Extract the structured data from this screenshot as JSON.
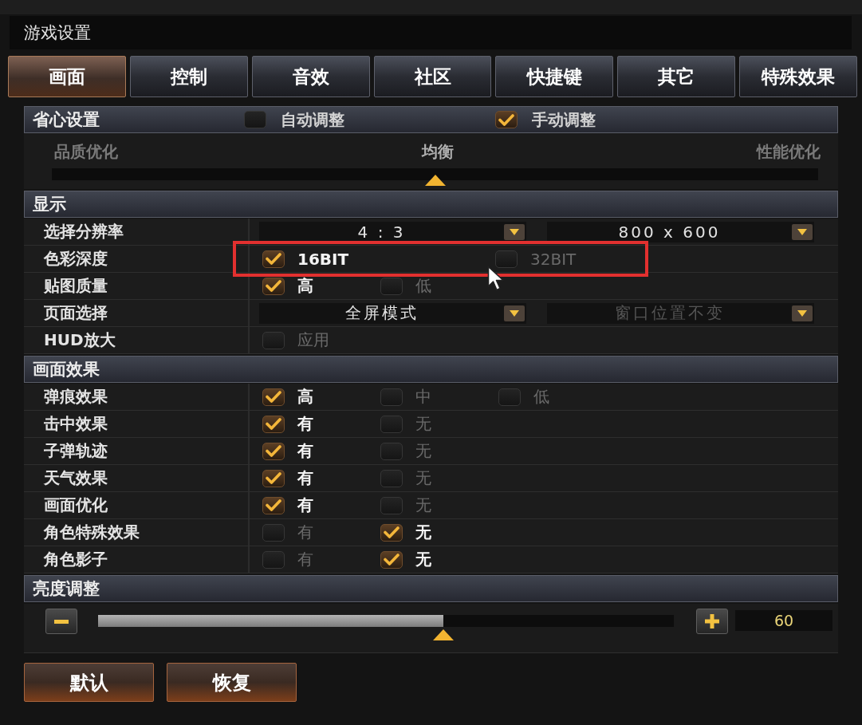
{
  "window": {
    "title": "游戏设置"
  },
  "tabs": [
    {
      "label": "画面",
      "selected": true
    },
    {
      "label": "控制",
      "selected": false
    },
    {
      "label": "音效",
      "selected": false
    },
    {
      "label": "社区",
      "selected": false
    },
    {
      "label": "快捷键",
      "selected": false
    },
    {
      "label": "其它",
      "selected": false
    },
    {
      "label": "特殊效果",
      "selected": false
    }
  ],
  "quick_settings": {
    "title": "省心设置",
    "options": [
      {
        "label": "自动调整",
        "checked": false
      },
      {
        "label": "手动调整",
        "checked": true
      }
    ],
    "preset_slider": {
      "labels": [
        {
          "text": "品质优化",
          "selected": false
        },
        {
          "text": "均衡",
          "selected": true
        },
        {
          "text": "性能优化",
          "selected": false
        }
      ],
      "level": 0.5
    }
  },
  "display": {
    "title": "显示",
    "rows": [
      {
        "label": "选择分辨率",
        "kind": "dropdowns",
        "highlighted": false,
        "dropdowns": [
          {
            "value": "4 : 3",
            "disabled": false
          },
          {
            "value": "800 x 600",
            "disabled": false
          }
        ]
      },
      {
        "label": "色彩深度",
        "kind": "wide-checks",
        "highlighted": true,
        "options": [
          {
            "label": "16BIT",
            "checked": true
          },
          {
            "label": "32BIT",
            "checked": false
          }
        ]
      },
      {
        "label": "贴图质量",
        "kind": "checks",
        "highlighted": false,
        "options": [
          {
            "label": "高",
            "checked": true
          },
          {
            "label": "低",
            "checked": false
          }
        ]
      },
      {
        "label": "页面选择",
        "kind": "dropdowns",
        "highlighted": false,
        "dropdowns": [
          {
            "value": "全屏模式",
            "disabled": false
          },
          {
            "value": "窗口位置不变",
            "disabled": true
          }
        ]
      },
      {
        "label": "HUD放大",
        "kind": "checks",
        "highlighted": false,
        "options": [
          {
            "label": "应用",
            "checked": false
          }
        ]
      }
    ]
  },
  "effects": {
    "title": "画面效果",
    "rows": [
      {
        "label": "弹痕效果",
        "kind": "checks",
        "options": [
          {
            "label": "高",
            "checked": true
          },
          {
            "label": "中",
            "checked": false
          },
          {
            "label": "低",
            "checked": false
          }
        ]
      },
      {
        "label": "击中效果",
        "kind": "checks",
        "options": [
          {
            "label": "有",
            "checked": true
          },
          {
            "label": "无",
            "checked": false
          }
        ]
      },
      {
        "label": "子弹轨迹",
        "kind": "checks",
        "options": [
          {
            "label": "有",
            "checked": true
          },
          {
            "label": "无",
            "checked": false
          }
        ]
      },
      {
        "label": "天气效果",
        "kind": "checks",
        "options": [
          {
            "label": "有",
            "checked": true
          },
          {
            "label": "无",
            "checked": false
          }
        ]
      },
      {
        "label": "画面优化",
        "kind": "checks",
        "options": [
          {
            "label": "有",
            "checked": true
          },
          {
            "label": "无",
            "checked": false
          }
        ]
      },
      {
        "label": "角色特殊效果",
        "kind": "checks",
        "options": [
          {
            "label": "有",
            "checked": false
          },
          {
            "label": "无",
            "checked": true
          }
        ]
      },
      {
        "label": "角色影子",
        "kind": "checks",
        "options": [
          {
            "label": "有",
            "checked": false
          },
          {
            "label": "无",
            "checked": true
          }
        ]
      }
    ]
  },
  "brightness": {
    "title": "亮度调整",
    "level": 0.6,
    "value": "60"
  },
  "buttons": [
    {
      "label": "默认"
    },
    {
      "label": "恢复"
    }
  ]
}
